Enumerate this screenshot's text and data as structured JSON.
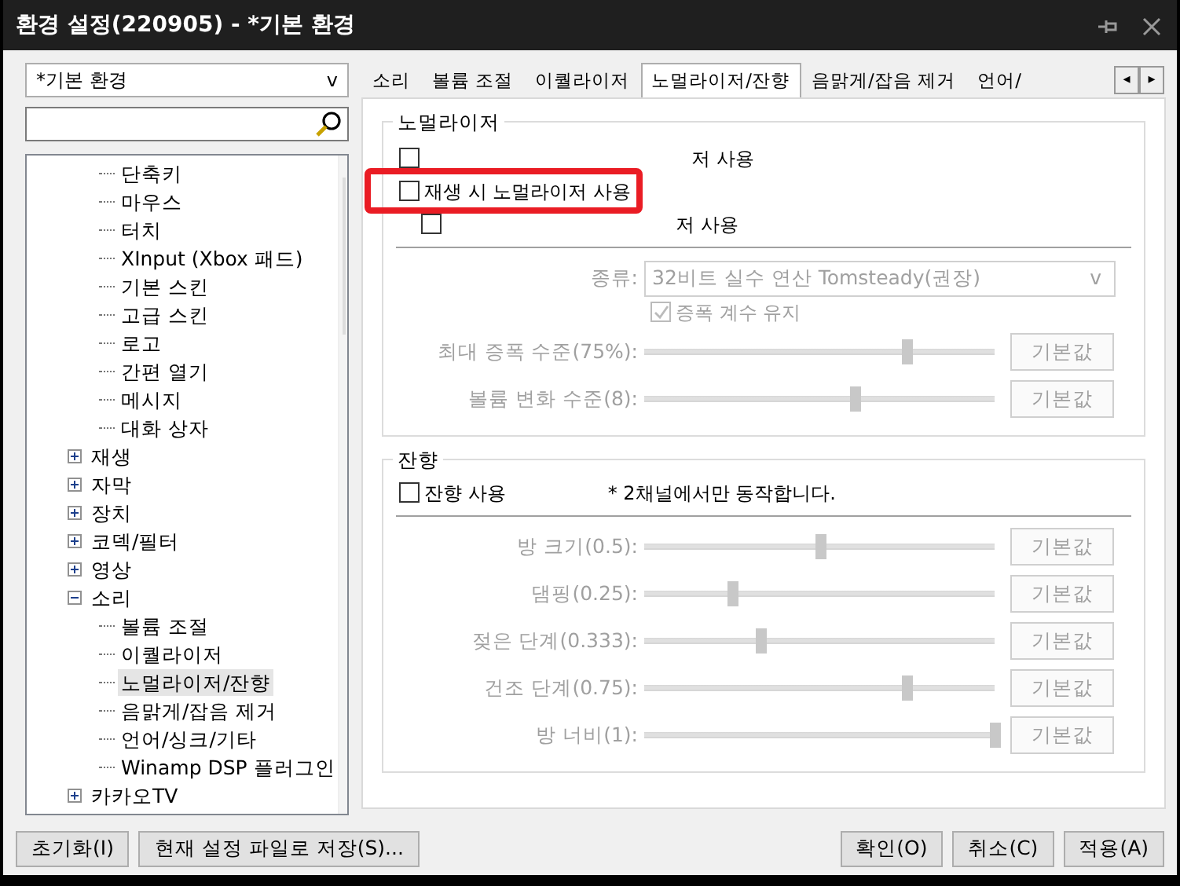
{
  "window": {
    "title": "환경 설정(220905) - *기본 환경"
  },
  "preset": {
    "value": "*기본 환경",
    "arrow": "v"
  },
  "tree": {
    "items": [
      {
        "children": [
          {
            "label": "단축키",
            "selected": false
          },
          {
            "label": "마우스",
            "selected": false
          },
          {
            "label": "터치",
            "selected": false
          },
          {
            "label": "XInput (Xbox 패드)",
            "selected": false
          },
          {
            "label": "기본 스킨",
            "selected": false
          },
          {
            "label": "고급 스킨",
            "selected": false
          },
          {
            "label": "로고",
            "selected": false
          },
          {
            "label": "간편 열기",
            "selected": false
          },
          {
            "label": "메시지",
            "selected": false
          },
          {
            "label": "대화 상자",
            "selected": false
          }
        ]
      },
      {
        "label": "재생",
        "expanded": false,
        "selected": false
      },
      {
        "label": "자막",
        "expanded": false,
        "selected": false
      },
      {
        "label": "장치",
        "expanded": false,
        "selected": false
      },
      {
        "label": "코덱/필터",
        "expanded": false,
        "selected": false
      },
      {
        "label": "영상",
        "expanded": false,
        "selected": false
      },
      {
        "label": "소리",
        "expanded": true,
        "selected": false,
        "children": [
          {
            "label": "볼륨 조절",
            "selected": false
          },
          {
            "label": "이퀄라이저",
            "selected": false
          },
          {
            "label": "노멀라이저/잔향",
            "selected": true
          },
          {
            "label": "음맑게/잡음 제거",
            "selected": false
          },
          {
            "label": "언어/싱크/기타",
            "selected": false
          },
          {
            "label": "Winamp DSP 플러그인",
            "selected": false
          }
        ]
      },
      {
        "label": "카카오TV",
        "expanded": false,
        "selected": false
      }
    ]
  },
  "tabs": [
    {
      "label": "소리",
      "selected": false
    },
    {
      "label": "볼륨 조절",
      "selected": false
    },
    {
      "label": "이퀄라이저",
      "selected": false
    },
    {
      "label": "노멀라이저/잔향",
      "selected": true
    },
    {
      "label": "음맑게/잡음 제거",
      "selected": false
    },
    {
      "label": "언어/",
      "selected": false
    }
  ],
  "tab_scroll": {
    "left": "◂",
    "right": "▸"
  },
  "normalizer": {
    "title": "노멀라이저",
    "checkboxes": [
      {
        "label": "저 사용",
        "checked": false
      },
      {
        "label": "재생 시 노멀라이저 사용",
        "checked": false
      },
      {
        "label": "저 사용",
        "checked": false
      }
    ],
    "type_label": "종류:",
    "type_value": "32비트 실수 연산 Tomsteady(권장)",
    "type_arrow": "v",
    "keep_gain": {
      "label": "증폭 계수 유지",
      "checked": true,
      "disabled": true
    },
    "sliders": [
      {
        "label": "최대 증폭 수준(75%):",
        "level": 0.75,
        "disabled": true,
        "button": "기본값"
      },
      {
        "label": "볼륨 변화 수준(8):",
        "level": 0.6,
        "disabled": true,
        "button": "기본값"
      }
    ]
  },
  "reverb": {
    "title": "잔향",
    "checkbox": {
      "label": "잔향 사용",
      "checked": false
    },
    "note": "* 2채널에서만 동작합니다.",
    "sliders": [
      {
        "label": "방 크기(0.5):",
        "level": 0.5,
        "disabled": true,
        "button": "기본값"
      },
      {
        "label": "댐핑(0.25):",
        "level": 0.25,
        "disabled": true,
        "button": "기본값"
      },
      {
        "label": "젖은 단계(0.333):",
        "level": 0.333,
        "disabled": true,
        "button": "기본값"
      },
      {
        "label": "건조 단계(0.75):",
        "level": 0.75,
        "disabled": true,
        "button": "기본값"
      },
      {
        "label": "방 너비(1):",
        "level": 1,
        "disabled": true,
        "button": "기본값"
      }
    ]
  },
  "footer": {
    "left": [
      "초기화(I)",
      "현재 설정 파일로 저장(S)..."
    ],
    "right": [
      "확인(O)",
      "취소(C)",
      "적용(A)"
    ]
  }
}
